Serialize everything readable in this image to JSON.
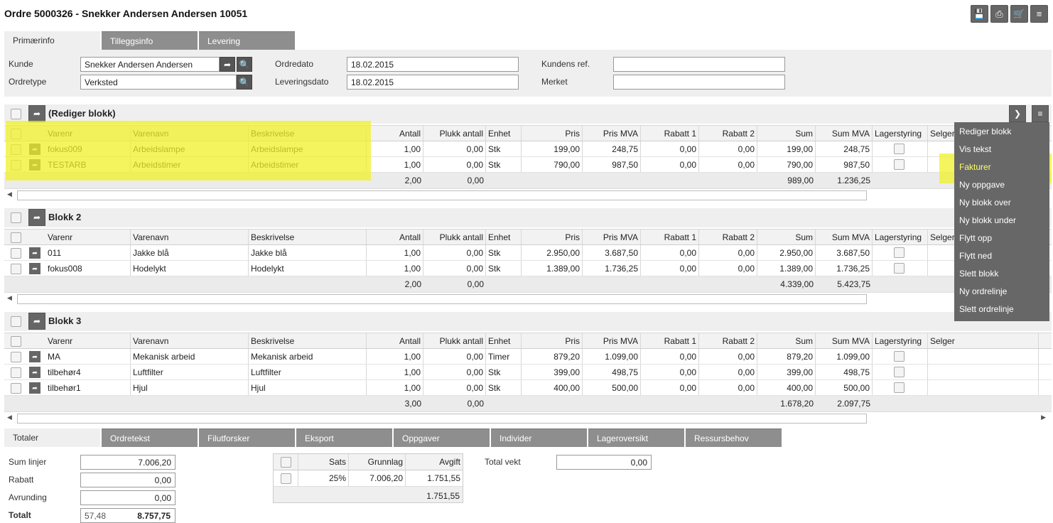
{
  "window": {
    "title": "Ordre 5000326 - Snekker Andersen Andersen 10051"
  },
  "toolbar": [
    {
      "name": "save-icon",
      "glyph": "💾"
    },
    {
      "name": "print-icon",
      "glyph": "⎙"
    },
    {
      "name": "cart-icon",
      "glyph": "🛒"
    },
    {
      "name": "menu-icon",
      "glyph": "≡"
    }
  ],
  "top_tabs": [
    "Primærinfo",
    "Tilleggsinfo",
    "Levering"
  ],
  "form": {
    "kunde_label": "Kunde",
    "kunde_value": "Snekker Andersen Andersen",
    "ordretype_label": "Ordretype",
    "ordretype_value": "Verksted",
    "ordredato_label": "Ordredato",
    "ordredato_value": "18.02.2015",
    "leveringsdato_label": "Leveringsdato",
    "leveringsdato_value": "18.02.2015",
    "kundensref_label": "Kundens ref.",
    "kundensref_value": "",
    "merket_label": "Merket",
    "merket_value": ""
  },
  "columns": [
    "Varenr",
    "Varenavn",
    "Beskrivelse",
    "Antall",
    "Plukk antall",
    "Enhet",
    "Pris",
    "Pris MVA",
    "Rabatt 1",
    "Rabatt 2",
    "Sum",
    "Sum MVA",
    "Lagerstyring",
    "Selger"
  ],
  "blocks": [
    {
      "title": "(Rediger blokk)",
      "rows": [
        [
          "fokus009",
          "Arbeidslampe",
          "Arbeidslampe",
          "1,00",
          "0,00",
          "Stk",
          "199,00",
          "248,75",
          "0,00",
          "0,00",
          "199,00",
          "248,75"
        ],
        [
          "TESTARB",
          "Arbeidstimer",
          "Arbeidstimer",
          "1,00",
          "0,00",
          "Stk",
          "790,00",
          "987,50",
          "0,00",
          "0,00",
          "790,00",
          "987,50"
        ]
      ],
      "totals": {
        "antall": "2,00",
        "plukk": "0,00",
        "sum": "989,00",
        "summva": "1.236,25"
      }
    },
    {
      "title": "Blokk 2",
      "rows": [
        [
          "011",
          "Jakke blå",
          "Jakke blå",
          "1,00",
          "0,00",
          "Stk",
          "2.950,00",
          "3.687,50",
          "0,00",
          "0,00",
          "2.950,00",
          "3.687,50"
        ],
        [
          "fokus008",
          "Hodelykt",
          "Hodelykt",
          "1,00",
          "0,00",
          "Stk",
          "1.389,00",
          "1.736,25",
          "0,00",
          "0,00",
          "1.389,00",
          "1.736,25"
        ]
      ],
      "totals": {
        "antall": "2,00",
        "plukk": "0,00",
        "sum": "4.339,00",
        "summva": "5.423,75"
      }
    },
    {
      "title": "Blokk 3",
      "rows": [
        [
          "MA",
          "Mekanisk arbeid",
          "Mekanisk arbeid",
          "1,00",
          "0,00",
          "Timer",
          "879,20",
          "1.099,00",
          "0,00",
          "0,00",
          "879,20",
          "1.099,00"
        ],
        [
          "tilbehør4",
          "Luftfilter",
          "Luftfilter",
          "1,00",
          "0,00",
          "Stk",
          "399,00",
          "498,75",
          "0,00",
          "0,00",
          "399,00",
          "498,75"
        ],
        [
          "tilbehør1",
          "Hjul",
          "Hjul",
          "1,00",
          "0,00",
          "Stk",
          "400,00",
          "500,00",
          "0,00",
          "0,00",
          "400,00",
          "500,00"
        ]
      ],
      "totals": {
        "antall": "3,00",
        "plukk": "0,00",
        "sum": "1.678,20",
        "summva": "2.097,75"
      }
    }
  ],
  "context_menu": [
    "Rediger blokk",
    "Vis tekst",
    "Fakturer",
    "Ny oppgave",
    "Ny blokk over",
    "Ny blokk under",
    "Flytt opp",
    "Flytt ned",
    "Slett blokk",
    "Ny ordrelinje",
    "Slett ordrelinje"
  ],
  "context_menu_highlight": "Fakturer",
  "bottom_tabs": [
    "Totaler",
    "Ordretekst",
    "Filutforsker",
    "Eksport",
    "Oppgaver",
    "Individer",
    "Lageroversikt",
    "Ressursbehov"
  ],
  "totals": {
    "sumlinjer_label": "Sum linjer",
    "sumlinjer_value": "7.006,20",
    "rabatt_label": "Rabatt",
    "rabatt_value": "0,00",
    "avrunding_label": "Avrunding",
    "avrunding_value": "0,00",
    "totalt_label": "Totalt",
    "totalt_pct": "57,48",
    "totalt_value": "8.757,75",
    "totalvekt_label": "Total vekt",
    "totalvekt_value": "0,00"
  },
  "mva_table": {
    "headers": [
      "Sats",
      "Grunnlag",
      "Avgift"
    ],
    "row": [
      "25%",
      "7.006,20",
      "1.751,55"
    ],
    "total": "1.751,55"
  },
  "colors": {
    "highlight": "#f0f028",
    "menu_bg": "#676767",
    "tab_bg": "#8e8e8e"
  }
}
